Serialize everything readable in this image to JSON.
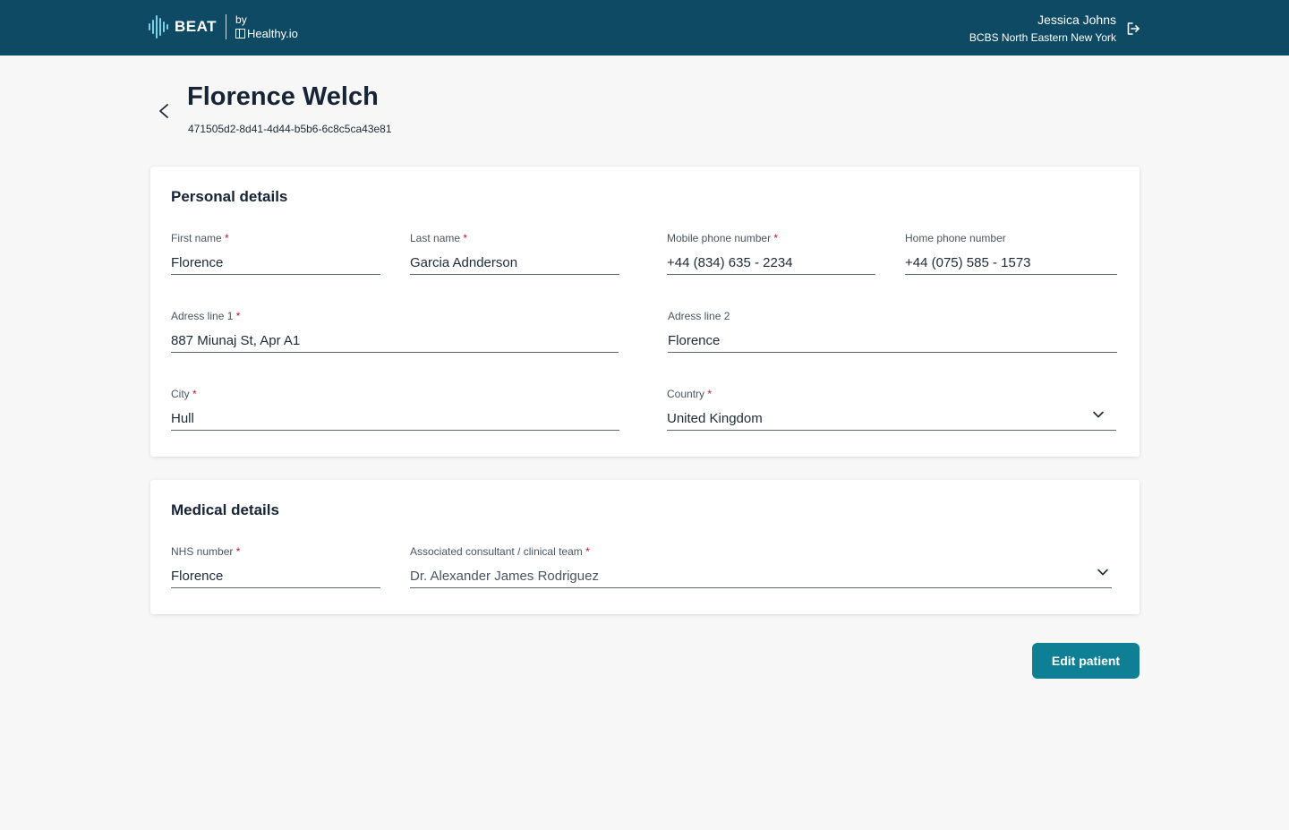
{
  "header": {
    "brand": "BEAT",
    "by": "by",
    "partner": "Healthy.io",
    "user_name": "Jessica Johns",
    "user_org": "BCBS North Eastern New York"
  },
  "patient": {
    "name": "Florence Welch",
    "id": "471505d2-8d41-4d44-b5b6-6c8c5ca43e81"
  },
  "personal": {
    "title": "Personal details",
    "first_name": {
      "label": "First name",
      "required": "*",
      "value": "Florence"
    },
    "last_name": {
      "label": "Last name",
      "required": "*",
      "value": "Garcia Adnderson"
    },
    "mobile": {
      "label": "Mobile phone number",
      "required": "*",
      "value": "+44 (834) 635 - 2234"
    },
    "home": {
      "label": "Home phone number",
      "value": "+44 (075) 585 - 1573"
    },
    "address1": {
      "label": "Adress line 1",
      "required": "*",
      "value": "887 Miunaj St, Apr A1"
    },
    "address2": {
      "label": "Adress line 2",
      "value": "Florence"
    },
    "city": {
      "label": "City",
      "required": "*",
      "value": "Hull"
    },
    "country": {
      "label": "Country",
      "required": "*",
      "value": "United Kingdom"
    }
  },
  "medical": {
    "title": "Medical details",
    "nhs": {
      "label": "NHS number",
      "required": "*",
      "value": "Florence"
    },
    "consultant": {
      "label": "Associated consultant / clinical team",
      "required": "*",
      "value": "Dr. Alexander James Rodriguez"
    }
  },
  "actions": {
    "edit": "Edit patient"
  },
  "colors": {
    "header_bg": "#0e4a64",
    "accent": "#0f7f96",
    "required": "#c8102e"
  }
}
